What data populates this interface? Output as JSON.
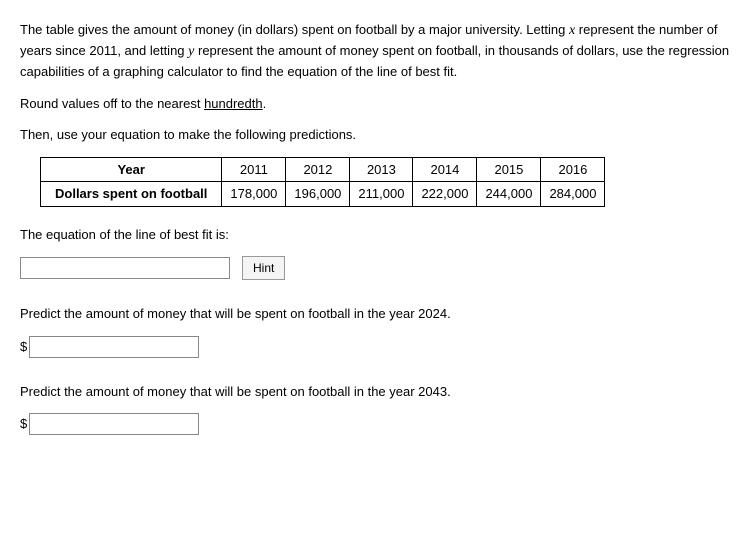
{
  "intro": {
    "p1a": "The table gives the amount of money (in dollars) spent on football by a major university. Letting ",
    "var_x": "x",
    "p1b": " represent the number of years since 2011, and letting ",
    "var_y": "y",
    "p1c": " represent the amount of money spent on football, in thousands of dollars, use the regression capabilities of a graphing calculator to find the equation of the line of best fit.",
    "p2a": "Round values off to the nearest ",
    "p2_underlined": "hundredth",
    "p2b": ".",
    "p3": "Then, use your equation to make the following predictions."
  },
  "table": {
    "row1_header": "Year",
    "row2_header": "Dollars spent on football",
    "years": [
      "2011",
      "2012",
      "2013",
      "2014",
      "2015",
      "2016"
    ],
    "values": [
      "178,000",
      "196,000",
      "211,000",
      "222,000",
      "244,000",
      "284,000"
    ]
  },
  "eq_section": {
    "label": "The equation of the line of best fit is:",
    "hint_label": "Hint",
    "input_value": ""
  },
  "predict1": {
    "label": "Predict the amount of money that will be spent on football in the year 2024.",
    "prefix": "$",
    "input_value": ""
  },
  "predict2": {
    "label": "Predict the amount of money that will be spent on football in the year 2043.",
    "prefix": "$",
    "input_value": ""
  }
}
